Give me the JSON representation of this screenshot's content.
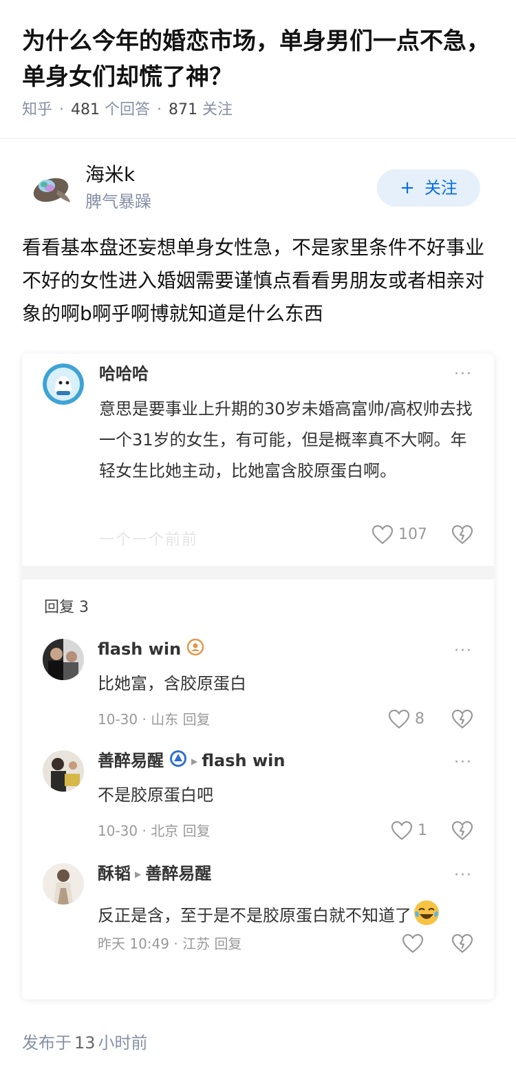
{
  "question": {
    "title": "为什么今年的婚恋市场，单身男们一点不急，单身女们却慌了神？",
    "source": "知乎",
    "answer_count": "481",
    "answer_label": "个回答",
    "follower_count": "871",
    "follower_label": "关注"
  },
  "answer": {
    "author_name": "海米k",
    "author_bio": "脾气暴躁",
    "follow_label": "关注",
    "follow_icon": "plus-icon",
    "text": "看看基本盘还妄想单身女性急，不是家里条件不好事业不好的女性进入婚姻需要谨慎点看看男朋友或者相亲对象的啊b啊乎啊博就知道是什么东西",
    "published_label": "发布于",
    "published_num": "13",
    "published_unit": "小时前"
  },
  "comment": {
    "name": "哈哈哈",
    "text": "意思是要事业上升期的30岁未婚高富帅/高权帅去找一个31岁的女生，有可能，但是概率真不大啊。年轻女生比她主动，比她富含胶原蛋白啊。",
    "faded": "一个一个前前",
    "likes": "107"
  },
  "replies": {
    "label": "回复 3",
    "items": [
      {
        "name": "flash win",
        "reply_to": "",
        "text": "比她富，含胶原蛋白",
        "date": "10-30",
        "location": "山东",
        "reply_label": "回复",
        "likes": "8"
      },
      {
        "name": "善醉易醒",
        "reply_to": "flash win",
        "text": "不是胶原蛋白吧",
        "date": "10-30",
        "location": "北京",
        "reply_label": "回复",
        "likes": "1"
      },
      {
        "name": "酥韬",
        "reply_to": "善醉易醒",
        "text": "反正是含，至于是不是胶原蛋白就不知道了",
        "date": "昨天 10:49",
        "location": "江苏",
        "reply_label": "回复",
        "likes": ""
      }
    ]
  },
  "colors": {
    "brand": "#056de8",
    "follow_bg": "#e6f0fb",
    "meta": "#8590a6",
    "emoji": "#f6c343"
  }
}
